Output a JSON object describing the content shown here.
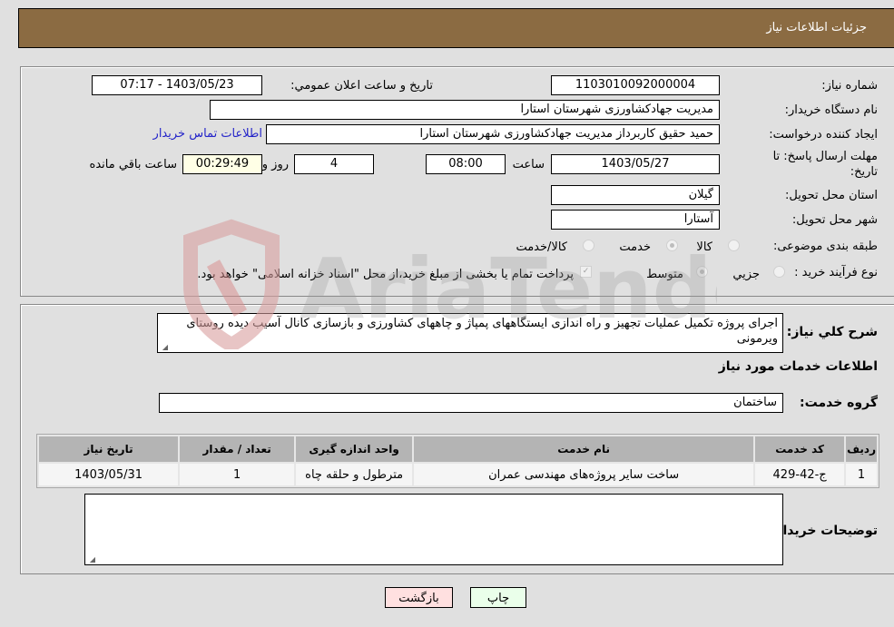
{
  "header": {
    "title": "جزئیات اطلاعات نیاز"
  },
  "form": {
    "need_number_label": "شماره نیاز:",
    "need_number": "1103010092000004",
    "announce_label": "تاریخ و ساعت اعلان عمومي:",
    "announce_value": "1403/05/23 - 07:17",
    "buyer_org_label": "نام دستگاه خریدار:",
    "buyer_org": "مدیریت جهادکشاورزی شهرستان استارا",
    "requester_label": "ایجاد کننده درخواست:",
    "requester": "حمید حقیق کاربرداز مدیریت جهادکشاورزی شهرستان استارا",
    "buyer_contact_link": "اطلاعات تماس خریدار",
    "deadline_label_line1": "مهلت ارسال پاسخ: تا",
    "deadline_label_line2": "تاریخ:",
    "deadline_date": "1403/05/27",
    "time_label": "ساعت",
    "deadline_time": "08:00",
    "days_value": "4",
    "days_label": "روز و",
    "remaining_time": "00:29:49",
    "remaining_label": "ساعت باقي مانده",
    "province_label": "استان محل تحویل:",
    "province": "گیلان",
    "city_label": "شهر محل تحویل:",
    "city": "آستارا",
    "category_label": "طبقه بندی موضوعی:",
    "category_options": [
      {
        "label": "کالا",
        "checked": false
      },
      {
        "label": "خدمت",
        "checked": true
      },
      {
        "label": "کالا/خدمت",
        "checked": false
      }
    ],
    "process_label": "نوع فرآیند خرید :",
    "process_options": [
      {
        "label": "جزيي",
        "checked": false
      },
      {
        "label": "متوسط",
        "checked": true
      }
    ],
    "treasury_checkbox_checked": true,
    "treasury_note": "پرداخت تمام یا بخشی از مبلغ خرید،از محل \"اسناد خزانه اسلامی\" خواهد بود."
  },
  "details": {
    "description_label": "شرح کلي نیاز:",
    "description": "اجرای پروژه تکمیل عملیات تجهیز و راه اندازی ایستگاههای پمپاژ و چاههای کشاورزی و بازسازی کانال آسیب دیده روستای ویرمونی",
    "services_title": "اطلاعات خدمات مورد نیاز",
    "service_group_label": "گروه خدمت:",
    "service_group": "ساختمان",
    "table": {
      "headers": [
        "ردیف",
        "کد خدمت",
        "نام خدمت",
        "واحد اندازه گیری",
        "تعداد / مقدار",
        "تاریخ نیاز"
      ],
      "rows": [
        [
          "1",
          "ج-42-429",
          "ساخت سایر پروژه‌های مهندسی عمران",
          "مترطول و حلقه چاه",
          "1",
          "1403/05/31"
        ]
      ]
    },
    "buyer_notes_label": "توضیحات خریدار:",
    "buyer_notes": ""
  },
  "buttons": {
    "print": "چاپ",
    "back": "بازگشت"
  },
  "watermark": {
    "text": "AriaTender.neT"
  },
  "colors": {
    "header_bg": "#8b6b42",
    "print_bg": "#eaffea",
    "back_bg": "#ffe0e0",
    "link": "#2424c9"
  }
}
